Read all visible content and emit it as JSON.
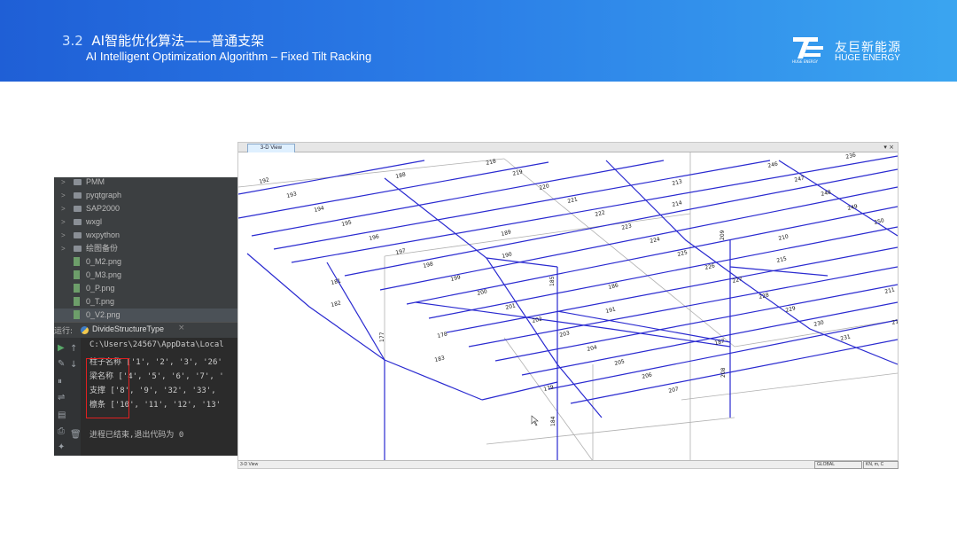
{
  "header": {
    "section_number": "3.2",
    "title_zh": "AI智能优化算法——普通支架",
    "title_en": "AI Intelligent Optimization Algorithm – Fixed Tilt Racking",
    "brand_zh": "友巨新能源",
    "brand_en": "HUGE ENERGY",
    "logo_text": "HUGE ENERGY"
  },
  "colors": {
    "banner_start": "#1f5fd6",
    "banner_end": "#3aa5f0",
    "member_line": "#2a2ad0",
    "highlight": "#e02020"
  },
  "ide": {
    "tree_items": [
      {
        "label": "PMM",
        "kind": "folder",
        "icon": "folder-icon"
      },
      {
        "label": "pyqtgraph",
        "kind": "folder",
        "icon": "folder-icon"
      },
      {
        "label": "SAP2000",
        "kind": "folder",
        "icon": "folder-icon"
      },
      {
        "label": "wxgl",
        "kind": "folder",
        "icon": "folder-icon"
      },
      {
        "label": "wxpython",
        "kind": "folder",
        "icon": "folder-icon"
      },
      {
        "label": "绘图备份",
        "kind": "folder",
        "icon": "folder-icon"
      },
      {
        "label": "0_M2.png",
        "kind": "file",
        "icon": "image-file-icon"
      },
      {
        "label": "0_M3.png",
        "kind": "file",
        "icon": "image-file-icon"
      },
      {
        "label": "0_P.png",
        "kind": "file",
        "icon": "image-file-icon"
      },
      {
        "label": "0_T.png",
        "kind": "file",
        "icon": "image-file-icon"
      },
      {
        "label": "0_V2.png",
        "kind": "file",
        "icon": "image-file-icon"
      }
    ],
    "run_label": "运行:",
    "run_config": "DivideStructureType",
    "close": "×",
    "console_lines": [
      "C:\\Users\\24567\\AppData\\Local",
      "柱子名称 ['1', '2', '3', '26'",
      "梁名称 ['4', '5', '6', '7', '",
      "支撑 ['8', '9', '32', '33',",
      "檩条 ['10', '11', '12', '13'",
      "",
      "进程已结束,退出代码为 0"
    ]
  },
  "view3d": {
    "tab_label": "3-D View",
    "controls": "▾ ×",
    "status_left": "3-D View",
    "coord_system": "GLOBAL",
    "units": "KN, m, C",
    "member_labels": [
      {
        "id": "218"
      },
      {
        "id": "219"
      },
      {
        "id": "220"
      },
      {
        "id": "221"
      },
      {
        "id": "222"
      },
      {
        "id": "223"
      },
      {
        "id": "224"
      },
      {
        "id": "225"
      },
      {
        "id": "226"
      },
      {
        "id": "227"
      },
      {
        "id": "228"
      },
      {
        "id": "229"
      },
      {
        "id": "230"
      },
      {
        "id": "231"
      },
      {
        "id": "246"
      },
      {
        "id": "247"
      },
      {
        "id": "248"
      },
      {
        "id": "249"
      },
      {
        "id": "250"
      },
      {
        "id": "192"
      },
      {
        "id": "193"
      },
      {
        "id": "194"
      },
      {
        "id": "195"
      },
      {
        "id": "196"
      },
      {
        "id": "197"
      },
      {
        "id": "198"
      },
      {
        "id": "199"
      },
      {
        "id": "200"
      },
      {
        "id": "201"
      },
      {
        "id": "202"
      },
      {
        "id": "203"
      },
      {
        "id": "204"
      },
      {
        "id": "205"
      },
      {
        "id": "206"
      },
      {
        "id": "207"
      },
      {
        "id": "188"
      },
      {
        "id": "189"
      },
      {
        "id": "190"
      },
      {
        "id": "181"
      },
      {
        "id": "182"
      },
      {
        "id": "183"
      },
      {
        "id": "177"
      },
      {
        "id": "178"
      },
      {
        "id": "179"
      },
      {
        "id": "184"
      },
      {
        "id": "185"
      },
      {
        "id": "186"
      },
      {
        "id": "191"
      },
      {
        "id": "187"
      },
      {
        "id": "208"
      },
      {
        "id": "209"
      },
      {
        "id": "210"
      },
      {
        "id": "215"
      },
      {
        "id": "213"
      },
      {
        "id": "214"
      },
      {
        "id": "211"
      },
      {
        "id": "212"
      },
      {
        "id": "236"
      }
    ]
  }
}
